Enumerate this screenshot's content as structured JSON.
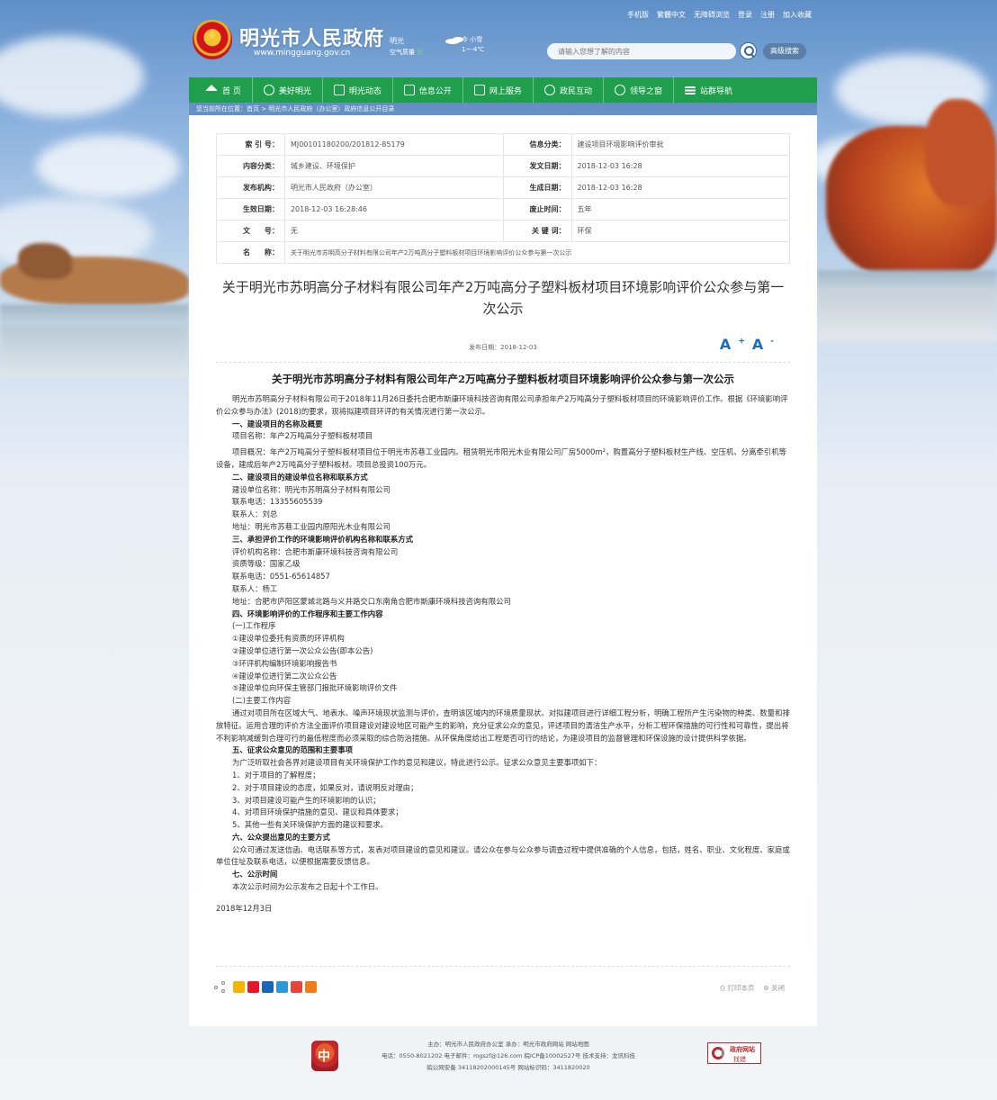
{
  "header": {
    "top_links": [
      "手机版",
      "繁體中文",
      "无障碍浏览",
      "登录",
      "注册",
      "加入收藏"
    ],
    "site_title": "明光市人民政府",
    "site_url": "www.mingguang.gov.cn",
    "city": "明光",
    "air_quality_label": "空气质量",
    "air_quality_value": "优",
    "weather_text": "今 小雪",
    "temperature": "1~-4℃",
    "search_placeholder": "请输入您想了解的内容",
    "advanced_search": "高级搜索"
  },
  "nav": {
    "items": [
      {
        "label": "首 页",
        "icon": "home-icon"
      },
      {
        "label": "美好明光",
        "icon": "landscape-icon"
      },
      {
        "label": "明光动态",
        "icon": "news-icon"
      },
      {
        "label": "信息公开",
        "icon": "info-icon"
      },
      {
        "label": "网上服务",
        "icon": "monitor-icon"
      },
      {
        "label": "政民互动",
        "icon": "chat-icon"
      },
      {
        "label": "领导之窗",
        "icon": "person-icon"
      },
      {
        "label": "站群导航",
        "icon": "menu-icon"
      }
    ]
  },
  "breadcrumb": "您当前所在位置：首页 > 明光市人民政府（办公室）政府信息公开目录",
  "meta": {
    "rows": [
      [
        {
          "k": "索 引 号：",
          "v": "MJ00101180200/201812-85179"
        },
        {
          "k": "信息分类：",
          "v": "建设项目环境影响评价审批"
        }
      ],
      [
        {
          "k": "内容分类：",
          "v": "城乡建设、环境保护"
        },
        {
          "k": "发文日期：",
          "v": "2018-12-03 16:28"
        }
      ],
      [
        {
          "k": "发布机构：",
          "v": "明光市人民政府（办公室）"
        },
        {
          "k": "生成日期：",
          "v": "2018-12-03 16:28"
        }
      ],
      [
        {
          "k": "生效日期：",
          "v": "2018-12-03 16:28:46"
        },
        {
          "k": "废止时间：",
          "v": "五年"
        }
      ],
      [
        {
          "k": "文　　号：",
          "v": "无"
        },
        {
          "k": "关 键 词：",
          "v": "环保"
        }
      ]
    ],
    "name_label": "名　　称：",
    "name_value": "关于明光市苏明高分子材料有限公司年产2万吨高分子塑料板材项目环境影响评价公众参与第一次公示"
  },
  "doc": {
    "title": "关于明光市苏明高分子材料有限公司年产2万吨高分子塑料板材项目环境影响评价公众参与第一次公示",
    "pub_date": "发布日期：2018-12-03",
    "font_larger": "A",
    "font_smaller": "A"
  },
  "article": {
    "title": "关于明光市苏明高分子材料有限公司年产2万吨高分子塑料板材项目环境影响评价公众参与第一次公示",
    "p01": "明光市苏明高分子材料有限公司于2018年11月26日委托合肥市斯康环境科技咨询有限公司承担年产2万吨高分子塑料板材项目的环境影响评价工作。根据《环境影响评价公众参与办法》(2018)的要求，现将拟建项目环评的有关情况进行第一次公示。",
    "h1": "一、建设项目的名称及概要",
    "p02": "项目名称：年产2万吨高分子塑料板材项目",
    "p03": "项目概况：年产2万吨高分子塑料板材项目位于明光市苏巷工业园内。租赁明光市阳光木业有限公司厂房5000m²，购置高分子塑料板材生产线、空压机、分离牵引机等设备，建成后年产2万吨高分子塑料板材。项目总投资100万元。",
    "h2": "二、建设项目的建设单位名称和联系方式",
    "p04": "建设单位名称：明光市苏明高分子材料有限公司",
    "p05": "联系电话：13355605539",
    "p06": "联系人：刘总",
    "p07": "地址：明光市苏巷工业园内原阳光木业有限公司",
    "h3": "三、承担评价工作的环境影响评价机构名称和联系方式",
    "p08": "评价机构名称：合肥市斯康环境科技咨询有限公司",
    "p09": "资质等级：国家乙级",
    "p10": "联系电话：0551-65614857",
    "p11": "联系人：杨工",
    "p12": "地址：合肥市庐阳区蒙城北路与义井路交口东南角合肥市斯康环境科技咨询有限公司",
    "h4": "四、环境影响评价的工作程序和主要工作内容",
    "p13": "(一)工作程序",
    "p14": "①建设单位委托有资质的环评机构",
    "p15": "②建设单位进行第一次公众公告(即本公告)",
    "p16": "③环评机构编制环境影响报告书",
    "p17": "④建设单位进行第二次公众公告",
    "p18": "⑤建设单位向环保主管部门报批环境影响评价文件",
    "p19": "(二)主要工作内容",
    "p20": "通过对项目所在区域大气、地表水、噪声环境现状监测与评价，查明该区域内的环境质量现状。对拟建项目进行详细工程分析，明确工程所产生污染物的种类、数量和排放特征。运用合理的评价方法全面评价项目建设对建设地区可能产生的影响，充分征求公众的意见，评述项目的清洁生产水平，分析工程环保措施的可行性和可靠性，提出将不利影响减缓到合理可行的最低程度而必须采取的综合防治措施。从环保角度给出工程是否可行的结论，为建设项目的监督管理和环保设施的设计提供科学依据。",
    "h5": "五、征求公众意见的范围和主要事项",
    "p21": "为广泛听取社会各界对建设项目有关环境保护工作的意见和建议，特此进行公示。征求公众意见主要事项如下：",
    "p22": "1、对于项目的了解程度；",
    "p23": "2、对于项目建设的态度，如果反对，请说明反对理由；",
    "p24": "3、对项目建设可能产生的环境影响的认识；",
    "p25": "4、对项目环境保护措施的意见、建议和具体要求；",
    "p26": "5、其他一些有关环境保护方面的建议和要求。",
    "h6": "六、公众提出意见的主要方式",
    "p27": "公众可通过发送信函、电话联系等方式，发表对项目建设的意见和建议。请公众在参与公众参与调查过程中提供准确的个人信息，包括，姓名、职业、文化程度、家庭或单位住址及联系电话，以便根据需要反馈信息。",
    "h7": "七、公示时间",
    "p28": "本次公示时间为公示发布之日起十个工作日。",
    "date": "2018年12月3日"
  },
  "tools": {
    "print": "打印本页",
    "close": "关闭"
  },
  "footer": {
    "line1": "主办：明光市人民政府办公室  承办：明光市政府网站  网站地图",
    "line2": "电话：0550-8021202  电子邮件：mgszf@126.com  皖ICP备10002527号  技术支持：龙讯科技",
    "line3": "皖公网安备 34118202000145号  网站标识码：3411820020",
    "badge_title": "政府网站",
    "badge_sub": "找错"
  }
}
